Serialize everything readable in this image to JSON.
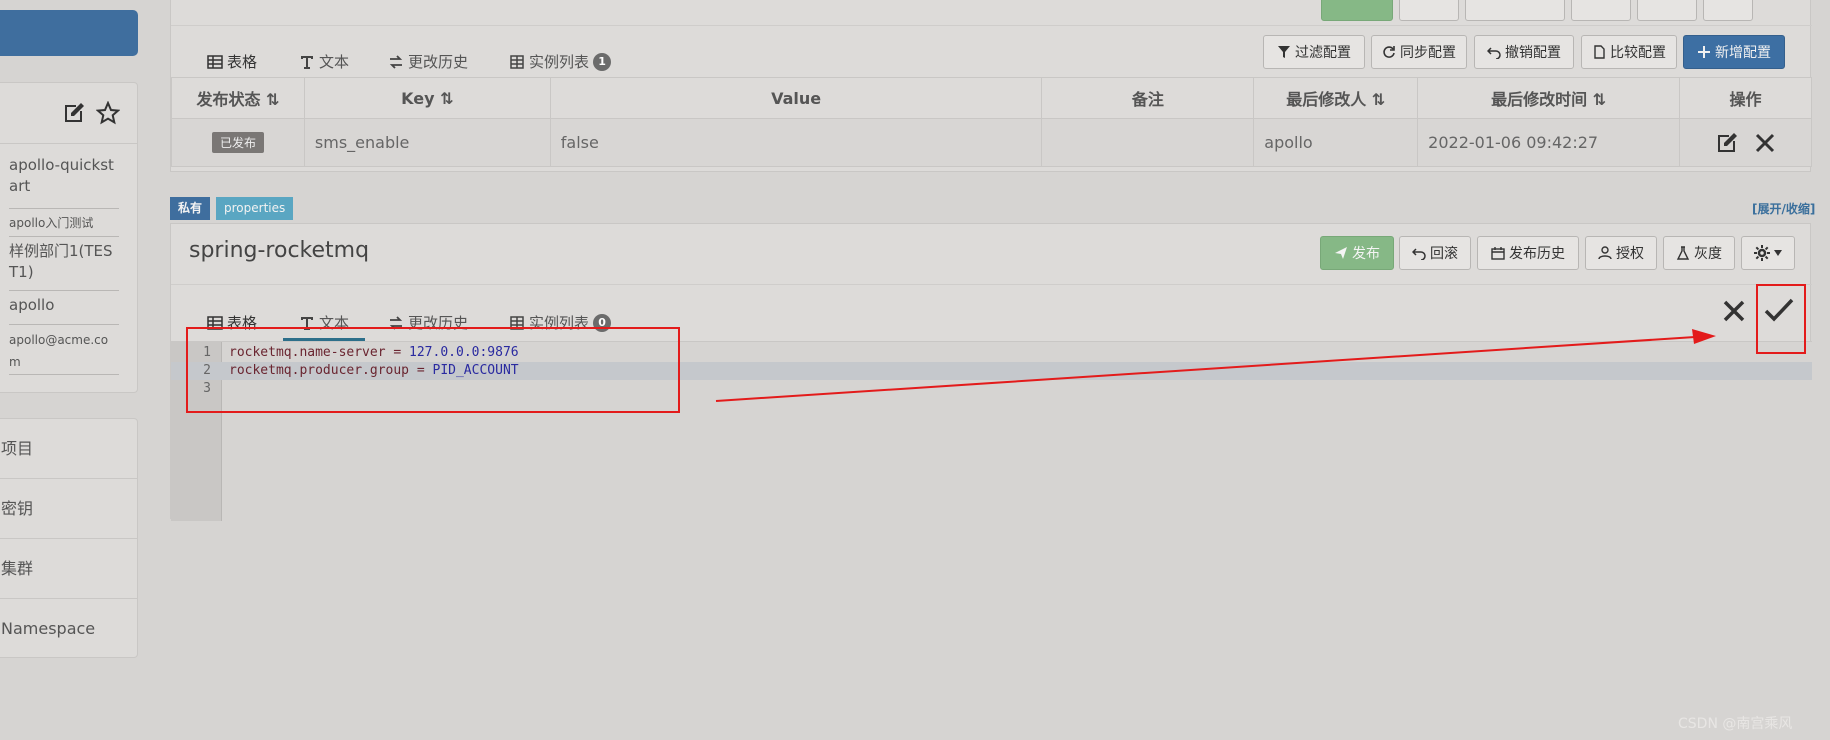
{
  "sidebar": {
    "app_info": {
      "rows": [
        "apollo-quickstart",
        "apollo入门测试",
        "样例部门1(TEST1)",
        "apollo",
        "apollo@acme.com"
      ]
    },
    "nav": [
      "项目",
      "密钥",
      "集群",
      "Namespace"
    ]
  },
  "ns1": {
    "tabs": {
      "table": "表格",
      "text": "文本",
      "history": "更改历史",
      "instances": "实例列表",
      "instances_count": "1"
    },
    "buttons": {
      "filter": "过滤配置",
      "sync": "同步配置",
      "revoke": "撤销配置",
      "compare": "比较配置",
      "add": "新增配置"
    },
    "table": {
      "headers": [
        "发布状态",
        "Key",
        "Value",
        "备注",
        "最后修改人",
        "最后修改时间",
        "操作"
      ],
      "rows": [
        {
          "status": "已发布",
          "key": "sms_enable",
          "value": "false",
          "comment": "",
          "modifier": "apollo",
          "time": "2022-01-06 09:42:27"
        }
      ]
    }
  },
  "ns2": {
    "tags": {
      "private": "私有",
      "format": "properties"
    },
    "expand": "[展开/收缩]",
    "title": "spring-rocketmq",
    "buttons": {
      "publish": "发布",
      "rollback": "回滚",
      "pub_history": "发布历史",
      "auth": "授权",
      "gray": "灰度"
    },
    "tabs": {
      "table": "表格",
      "text": "文本",
      "history": "更改历史",
      "instances": "实例列表",
      "instances_count": "0"
    },
    "editor": {
      "lines": [
        {
          "n": "1",
          "key": "rocketmq.name-server",
          "eq": " = ",
          "val": "127.0.0.0:9876"
        },
        {
          "n": "2",
          "key": "rocketmq.producer.group",
          "eq": " = ",
          "val": "PID_ACCOUNT"
        },
        {
          "n": "3",
          "key": "",
          "eq": "",
          "val": ""
        }
      ]
    }
  },
  "watermark": "CSDN @南宫乘风",
  "colors": {
    "accent": "#3d6fa3",
    "success": "#86b886",
    "annotation": "#e31b1b",
    "tag_private": "#3f6e9e",
    "tag_format": "#5aa6c2"
  }
}
